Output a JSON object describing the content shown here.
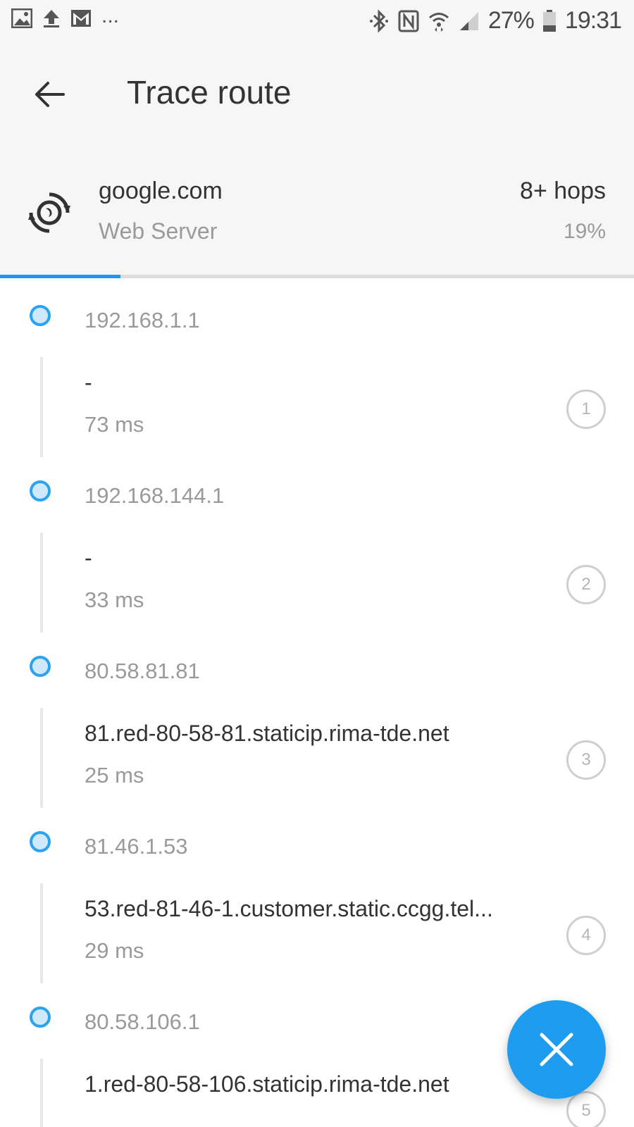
{
  "status_bar": {
    "battery": "27%",
    "time": "19:31",
    "overflow": "...",
    "left_icons": [
      "image-icon",
      "upload-icon",
      "gmail-icon"
    ],
    "right_icons": [
      "bluetooth-icon",
      "nfc-icon",
      "wifi-icon",
      "signal-icon",
      "battery-icon"
    ]
  },
  "app_bar": {
    "title": "Trace route"
  },
  "target": {
    "host": "google.com",
    "type": "Web Server",
    "hops": "8+ hops",
    "percent": "19%",
    "progress": 0.19
  },
  "hops": [
    {
      "ip": "192.168.1.1",
      "host": "-",
      "time": "73 ms",
      "num": "1"
    },
    {
      "ip": "192.168.144.1",
      "host": "-",
      "time": "33 ms",
      "num": "2"
    },
    {
      "ip": "80.58.81.81",
      "host": "81.red-80-58-81.staticip.rima-tde.net",
      "time": "25 ms",
      "num": "3"
    },
    {
      "ip": "81.46.1.53",
      "host": "53.red-81-46-1.customer.static.ccgg.tel...",
      "time": "29 ms",
      "num": "4"
    },
    {
      "ip": "80.58.106.1",
      "host": "1.red-80-58-106.staticip.rima-tde.net",
      "time": "",
      "num": "5"
    }
  ],
  "fab": {
    "icon": "close-icon"
  },
  "colors": {
    "accent": "#2196f3",
    "fab": "#1e9cf0",
    "dot_fill": "#cfe9fb",
    "dot_border": "#2ba3ef"
  }
}
